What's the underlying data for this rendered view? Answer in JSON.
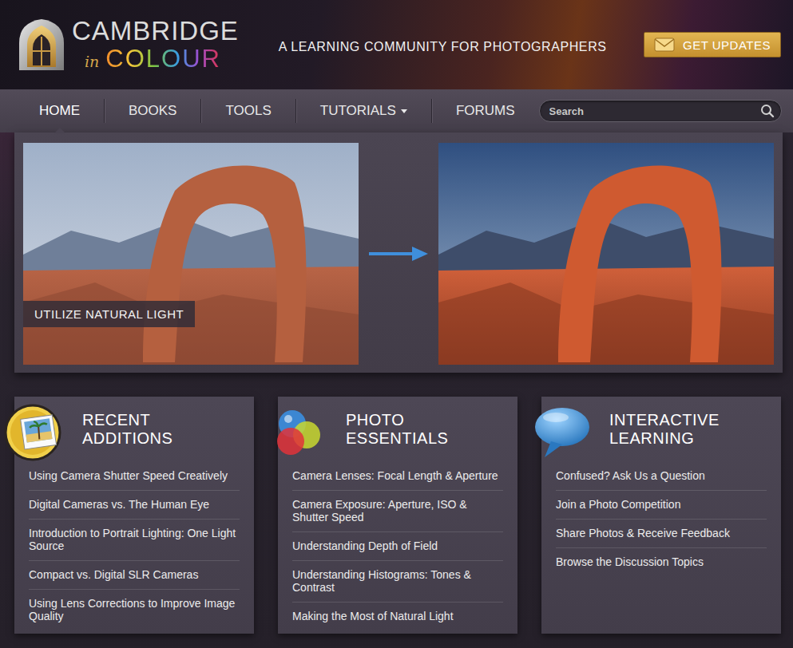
{
  "brand": {
    "name": "CAMBRIDGE",
    "joiner": "in",
    "color_word": "COLOUR"
  },
  "tagline": "A LEARNING COMMUNITY FOR PHOTOGRAPHERS",
  "updates_button": {
    "label": "GET UPDATES"
  },
  "nav": [
    {
      "label": "HOME",
      "selected": true,
      "dropdown": false
    },
    {
      "label": "BOOKS",
      "selected": false,
      "dropdown": false
    },
    {
      "label": "TOOLS",
      "selected": false,
      "dropdown": false
    },
    {
      "label": "TUTORIALS",
      "selected": false,
      "dropdown": true
    },
    {
      "label": "FORUMS",
      "selected": false,
      "dropdown": false
    }
  ],
  "search": {
    "placeholder": "Search"
  },
  "hero": {
    "caption": "UTILIZE NATURAL LIGHT"
  },
  "panels": [
    {
      "kind": "photo",
      "title": [
        "RECENT",
        "ADDITIONS"
      ],
      "links": [
        "Using Camera Shutter Speed Creatively",
        "Digital Cameras vs. The Human Eye",
        "Introduction to Portrait Lighting: One Light Source",
        "Compact vs. Digital SLR Cameras",
        "Using Lens Corrections to Improve Image Quality"
      ]
    },
    {
      "kind": "circles",
      "title": [
        "PHOTO",
        "ESSENTIALS"
      ],
      "links": [
        "Camera Lenses: Focal Length & Aperture",
        "Camera Exposure: Aperture, ISO & Shutter Speed",
        "Understanding Depth of Field",
        "Understanding Histograms: Tones & Contrast",
        "Making the Most of Natural Light"
      ]
    },
    {
      "kind": "bubble",
      "title": [
        "INTERACTIVE",
        "LEARNING"
      ],
      "links": [
        "Confused? Ask Us a Question",
        "Join a Photo Competition",
        "Share Photos & Receive Feedback",
        "Browse the Discussion Topics"
      ]
    }
  ]
}
